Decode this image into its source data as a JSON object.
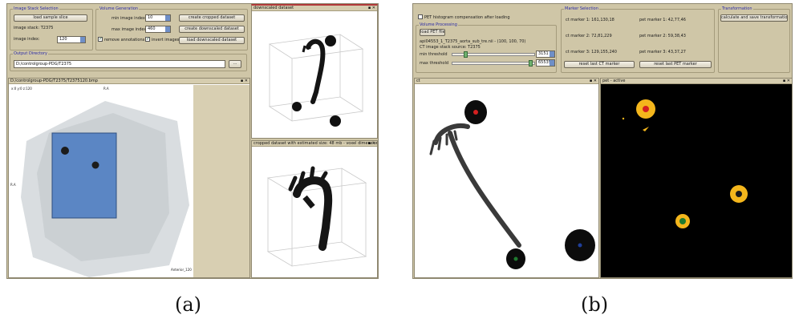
{
  "left": {
    "image_stack_group": {
      "title": "Image Stack Selection",
      "load_button": "load sample slice",
      "image_stack_label": "image stack: T2375",
      "image_index_label": "image index:",
      "image_index_value": "120"
    },
    "volume_group": {
      "title": "Volume Generation",
      "min_label": "min image index:",
      "min_value": "10",
      "max_label": "max image index:",
      "max_value": "460",
      "create_cropped": "create cropped dataset",
      "create_downscaled": "create downscaled dataset",
      "load_downscaled": "load downscaled dataset",
      "remove_annotations": "remove annotations",
      "invert_images": "invert images"
    },
    "output_group": {
      "title": "Output Directory",
      "path": "D:/controlgroup-PDG/T2375",
      "browse": "..."
    },
    "slice_panel": {
      "title": "D:/controlgroup-PDG/T2375/T2375120.bmp",
      "corner_tl": "x:0 y:0 z:120",
      "label_right": "R.A",
      "label_left": "R.A",
      "corner_br": "Anterior_120"
    },
    "downscaled_panel": {
      "title": "downscaled dataset"
    },
    "cropped_panel": {
      "title": "cropped dataset with estimated size: 48 mb - voxel dimension..."
    }
  },
  "right": {
    "pet_checkbox_label": "PET histogram compensation after loading",
    "volume_group": {
      "title": "Volume Processing",
      "load_pet": "load PET file",
      "file_label": "api04553_1_T2375_aorta_sub_tre.nii - (100, 100, 70)",
      "ct_source": "CT image stack source: T2375",
      "min_label": "min threshold",
      "min_value": "3151",
      "max_label": "max threshold",
      "max_value": "65535",
      "min_fraction": 0.14,
      "max_fraction": 0.97
    },
    "marker_group": {
      "title": "Marker Selection",
      "ct1": "ct marker 1: 161,130,18",
      "pet1": "pet marker 1: 42,77,46",
      "ct2": "ct marker 2: 72,81,229",
      "pet2": "pet marker 2: 59,38,43",
      "ct3": "ct marker 3: 129,155,240",
      "pet3": "pet marker 3: 43,37,27",
      "reset_ct": "reset last CT marker",
      "reset_pet": "reset last PET marker"
    },
    "transform_group": {
      "title": "Transformation",
      "calc_button": "calculate and save transformation"
    },
    "ct_panel": {
      "title": "ct"
    },
    "pet_panel": {
      "title": "pet - active"
    }
  },
  "captions": {
    "a": "(a)",
    "b": "(b)"
  },
  "colors": {
    "panel_bg": "#cfc6a7",
    "group_title": "#2a2aa6",
    "selection_box": "#5b86c4",
    "pet_marker": "#f4b61c",
    "marker_red": "#d42020",
    "marker_green": "#1f7a2f",
    "marker_blue": "#1f3f9a"
  }
}
